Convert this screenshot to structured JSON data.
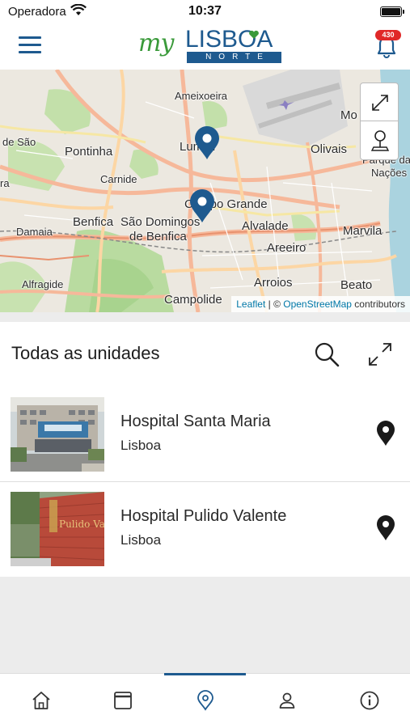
{
  "status_bar": {
    "carrier": "Operadora",
    "time": "10:37"
  },
  "header": {
    "logo": {
      "my": "my",
      "lisboa": "LISBOA",
      "norte": "NORTE"
    },
    "notification_count": "430"
  },
  "map": {
    "labels": [
      "Ameixoeira",
      "Pontinha",
      "Carnide",
      "Lumiar",
      "Campo Grande",
      "Olivais",
      "Benfica",
      "São Domingos",
      "de Benfica",
      "Alvalade",
      "Damaia",
      "Areeiro",
      "Marvila",
      "Alfragide",
      "Arroios",
      "Beato",
      "Campolide",
      "Parque das",
      "Nações",
      "Mo",
      "de São",
      "ra"
    ],
    "attribution": {
      "leaflet": "Leaflet",
      "separator": " | © ",
      "osm": "OpenStreetMap",
      "suffix": " contributors"
    },
    "controls": [
      "fullscreen-icon",
      "location-pin-icon"
    ]
  },
  "units": {
    "title": "Todas as unidades",
    "items": [
      {
        "name": "Hospital Santa Maria",
        "city": "Lisboa"
      },
      {
        "name": "Hospital Pulido Valente",
        "city": "Lisboa"
      }
    ]
  },
  "tabs": [
    {
      "icon": "home-icon"
    },
    {
      "icon": "calendar-icon"
    },
    {
      "icon": "location-icon",
      "active": true
    },
    {
      "icon": "profile-icon"
    },
    {
      "icon": "info-icon"
    }
  ],
  "colors": {
    "brand_blue": "#1e5a8f",
    "brand_green": "#3a9a3a",
    "badge_red": "#e02828"
  }
}
